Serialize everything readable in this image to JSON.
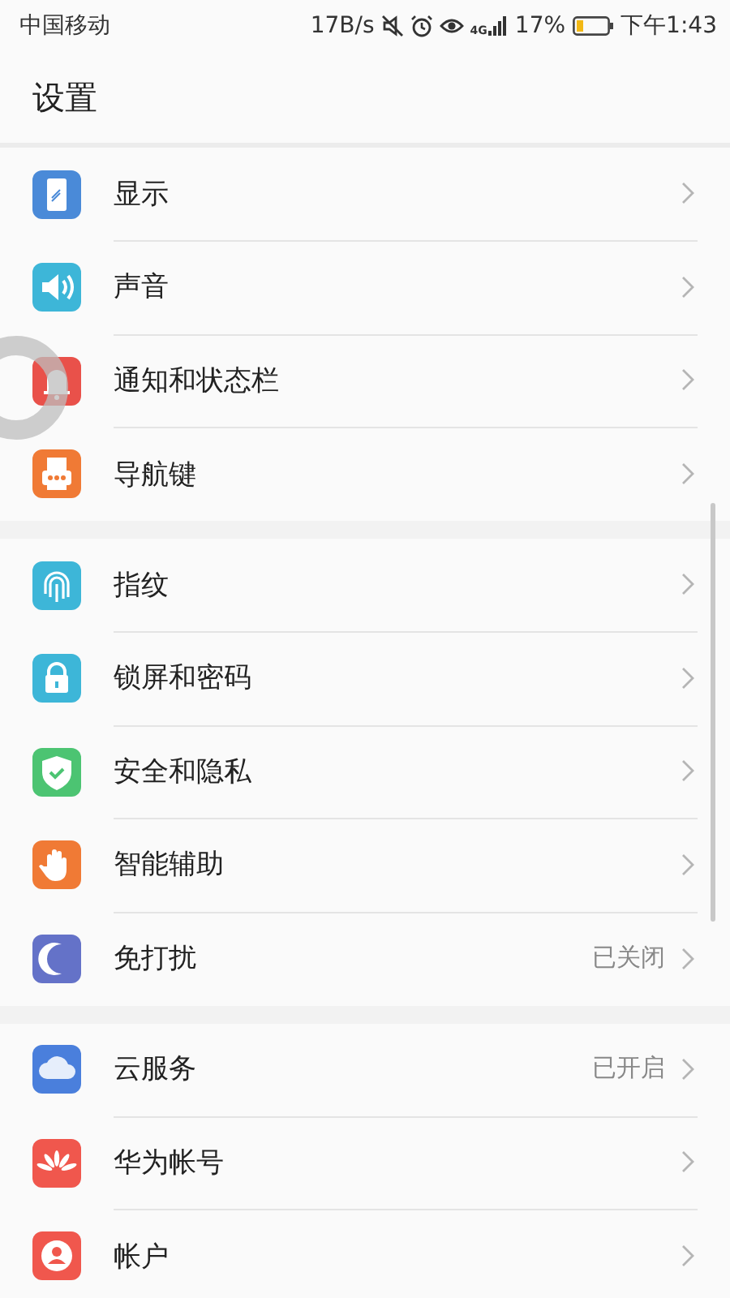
{
  "status_bar": {
    "carrier": "中国移动",
    "speed": "17B/s",
    "network": "4G",
    "battery": "17%",
    "time": "下午1:43"
  },
  "title": "设置",
  "groups": [
    {
      "items": [
        {
          "label": "显示"
        },
        {
          "label": "声音"
        },
        {
          "label": "通知和状态栏"
        },
        {
          "label": "导航键"
        }
      ]
    },
    {
      "items": [
        {
          "label": "指纹"
        },
        {
          "label": "锁屏和密码"
        },
        {
          "label": "安全和隐私"
        },
        {
          "label": "智能辅助"
        },
        {
          "label": "免打扰",
          "value": "已关闭"
        }
      ]
    },
    {
      "items": [
        {
          "label": "云服务",
          "value": "已开启"
        },
        {
          "label": "华为帐号"
        },
        {
          "label": "帐户"
        }
      ]
    }
  ]
}
